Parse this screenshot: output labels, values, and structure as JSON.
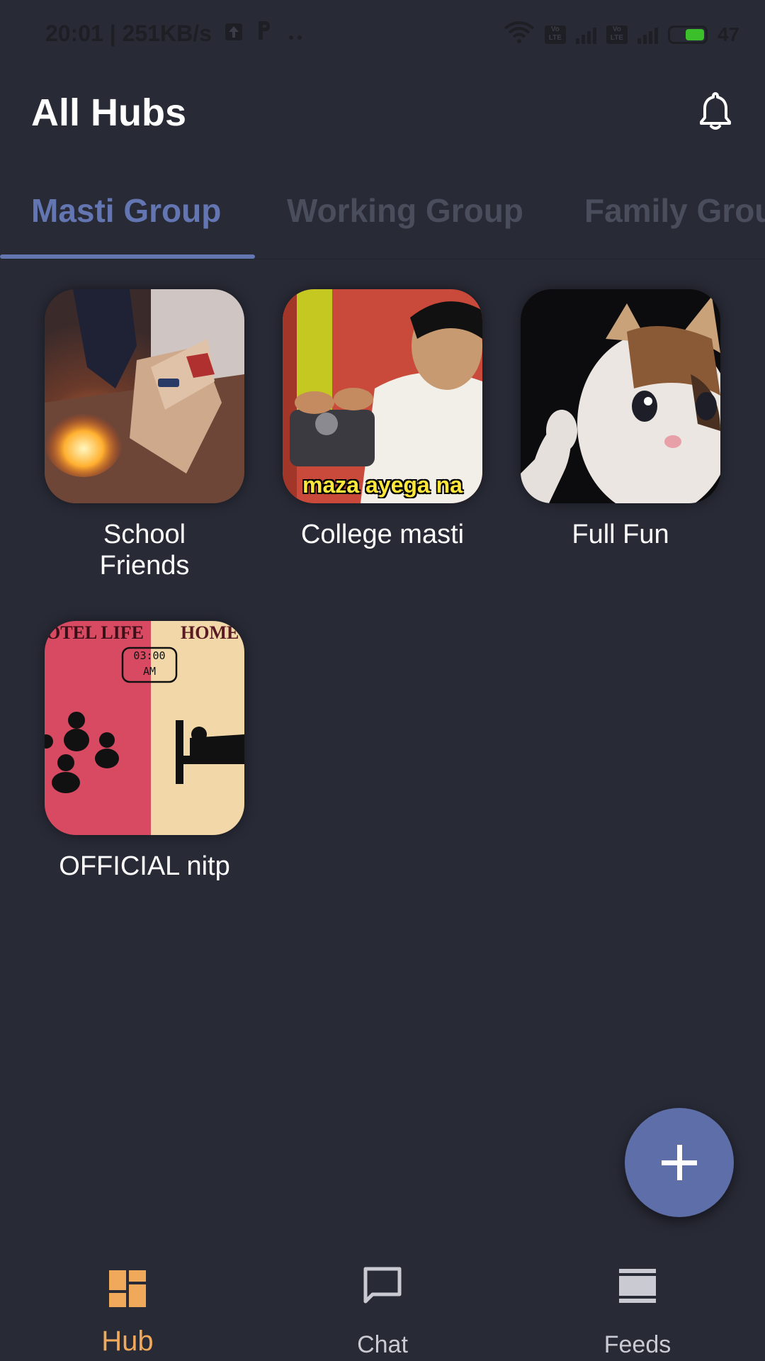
{
  "status_bar": {
    "time_speed": "20:01 | 251KB/s",
    "battery": "47"
  },
  "header": {
    "title": "All Hubs",
    "notification_icon": "bell-icon"
  },
  "tabs": [
    {
      "label": "Masti Group",
      "active": true
    },
    {
      "label": "Working Group",
      "active": false
    },
    {
      "label": "Family Grou",
      "active": false
    }
  ],
  "hubs": [
    {
      "name": "School Friends"
    },
    {
      "name": "College masti",
      "caption": "maza ayega na"
    },
    {
      "name": "Full Fun"
    },
    {
      "name": "OFFICIAL nitp",
      "left_text": "OTEL LIFE",
      "right_text": "HOME",
      "clock": "03:00",
      "clock_ampm": "AM"
    }
  ],
  "fab": {
    "icon": "plus-icon"
  },
  "bottom_nav": [
    {
      "label": "Hub",
      "icon": "dashboard-icon",
      "active": true
    },
    {
      "label": "Chat",
      "icon": "chat-icon",
      "active": false
    },
    {
      "label": "Feeds",
      "icon": "feeds-icon",
      "active": false
    }
  ],
  "colors": {
    "background": "#282a36",
    "accent": "#6476b2",
    "nav_active": "#f0a85a",
    "nav_inactive": "#c9cad2"
  }
}
